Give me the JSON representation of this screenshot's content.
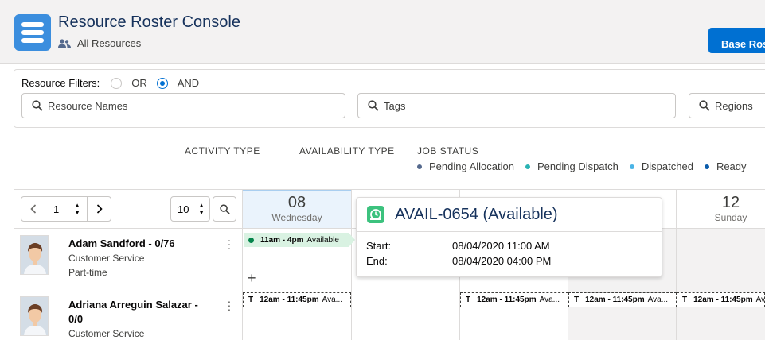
{
  "header": {
    "title": "Resource Roster Console",
    "subtitle": "All Resources",
    "base_button": "Base Roster"
  },
  "filters": {
    "label": "Resource Filters:",
    "options": [
      "OR",
      "AND"
    ],
    "selected": "AND",
    "search_names": "Resource Names",
    "search_tags": "Tags",
    "search_regions": "Regions"
  },
  "legend": {
    "activity_type": "ACTIVITY TYPE",
    "availability_type": "AVAILABILITY TYPE",
    "job_status": "JOB STATUS",
    "items": [
      {
        "label": "Pending Allocation",
        "color": "#54698d"
      },
      {
        "label": "Pending Dispatch",
        "color": "#2ab3b3"
      },
      {
        "label": "Dispatched",
        "color": "#4bb4e6"
      },
      {
        "label": "Ready",
        "color": "#0b5cab"
      }
    ]
  },
  "pager": {
    "page": "1",
    "page_size": "10"
  },
  "days": [
    {
      "num": "08",
      "name": "Wednesday"
    },
    {
      "num": "12",
      "name": "Sunday"
    }
  ],
  "resources": [
    {
      "name": "Adam Sandford - 0/76",
      "line1": "Customer Service",
      "line2": "Part-time"
    },
    {
      "name": "Adriana Arreguin Salazar -",
      "name2": "0/0",
      "line1": "Customer Service"
    }
  ],
  "availability": {
    "time": "11am - 4pm",
    "label": "Available"
  },
  "time_slots": {
    "prefix": "T",
    "time": "12am - 11:45pm",
    "label": "Ava..."
  },
  "popover": {
    "title": "AVAIL-0654 (Available)",
    "start_label": "Start:",
    "start_value": "08/04/2020 11:00 AM",
    "end_label": "End:",
    "end_value": "08/04/2020 04:00 PM"
  }
}
